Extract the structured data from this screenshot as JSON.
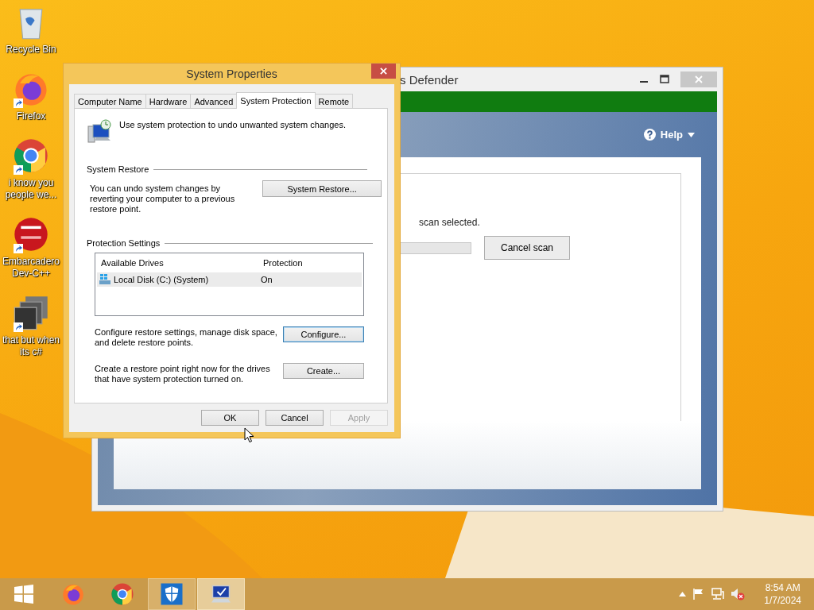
{
  "desktop_icons": [
    {
      "kind": "recycle-bin",
      "label": "Recycle Bin",
      "shortcut": false
    },
    {
      "kind": "firefox",
      "label": "Firefox",
      "shortcut": true
    },
    {
      "kind": "chrome",
      "label": "i know you people we...",
      "shortcut": true
    },
    {
      "kind": "devcpp",
      "label": "Embarcadero Dev-C++",
      "shortcut": true
    },
    {
      "kind": "stack",
      "label": "that but when its c#",
      "shortcut": true
    }
  ],
  "defender_window": {
    "title": "s Defender",
    "help": "Help",
    "status": "scan selected.",
    "progress": {
      "level": 0
    },
    "cancel_button": "Cancel scan"
  },
  "system_properties": {
    "title": "System Properties",
    "tabs": [
      {
        "label": "Computer Name",
        "selected": false
      },
      {
        "label": "Hardware",
        "selected": false
      },
      {
        "label": "Advanced",
        "selected": false
      },
      {
        "label": "System Protection",
        "selected": true
      },
      {
        "label": "Remote",
        "selected": false
      }
    ],
    "intro": "Use system protection to undo unwanted system changes.",
    "system_restore": {
      "heading": "System Restore",
      "text": "You can undo system changes by reverting your computer to a previous restore point.",
      "button": "System Restore..."
    },
    "protection_settings": {
      "heading": "Protection Settings",
      "columns": [
        "Available Drives",
        "Protection"
      ],
      "drives": [
        {
          "name": "Local Disk (C:) (System)",
          "protection": "On",
          "selected": true
        }
      ],
      "configure_text": "Configure restore settings, manage disk space, and delete restore points.",
      "configure_button": {
        "label": "Configure...",
        "focused": true
      },
      "create_text": "Create a restore point right now for the drives that have system protection turned on.",
      "create_button": {
        "label": "Create...",
        "focused": false
      }
    },
    "buttons": [
      {
        "label": "OK",
        "disabled": false
      },
      {
        "label": "Cancel",
        "disabled": false
      },
      {
        "label": "Apply",
        "disabled": true
      }
    ]
  },
  "taskbar": {
    "items": [
      {
        "kind": "start",
        "open": false,
        "selected": false
      },
      {
        "kind": "firefox",
        "open": false,
        "selected": false
      },
      {
        "kind": "chrome",
        "open": false,
        "selected": false
      },
      {
        "kind": "defender",
        "open": true,
        "selected": false
      },
      {
        "kind": "system",
        "open": true,
        "selected": true
      }
    ],
    "time": "8:54 AM",
    "date": "1/7/2024"
  }
}
